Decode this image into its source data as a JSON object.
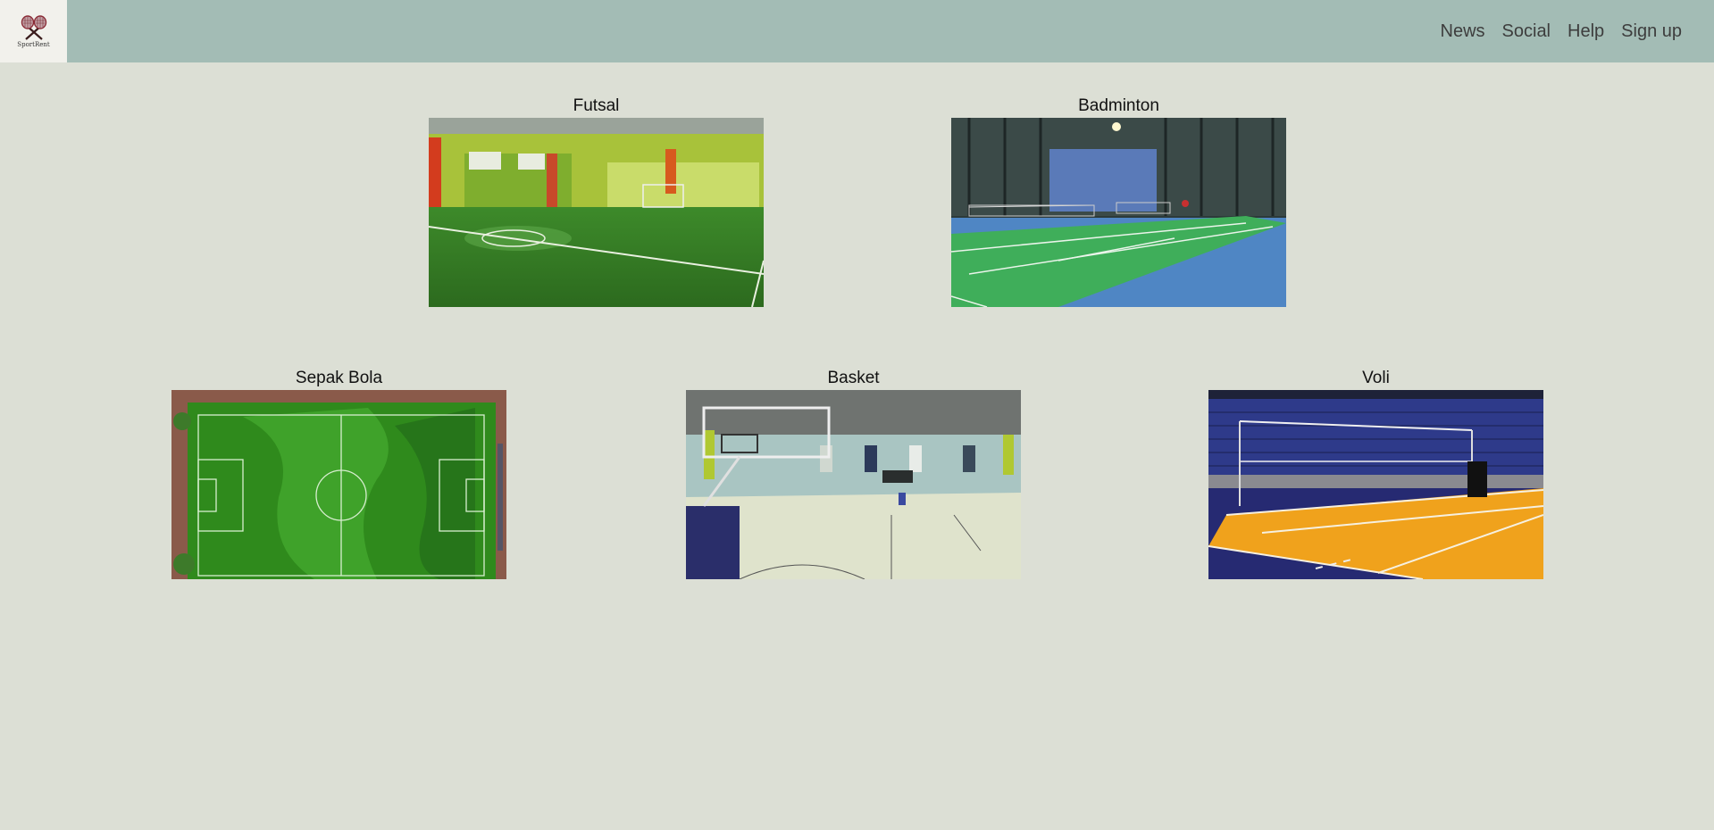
{
  "brand": {
    "logo_text": "SportRent"
  },
  "nav": {
    "links": [
      "News",
      "Social",
      "Help",
      "Sign up"
    ]
  },
  "venues": [
    {
      "title": "Futsal"
    },
    {
      "title": "Badminton"
    },
    {
      "title": "Sepak Bola"
    },
    {
      "title": "Basket"
    },
    {
      "title": "Voli"
    }
  ],
  "colors": {
    "page_background": "#dcdfd5",
    "navbar": "#a3bcb5",
    "logo_background": "#f2f1ec",
    "nav_text": "#3d3d3d"
  }
}
